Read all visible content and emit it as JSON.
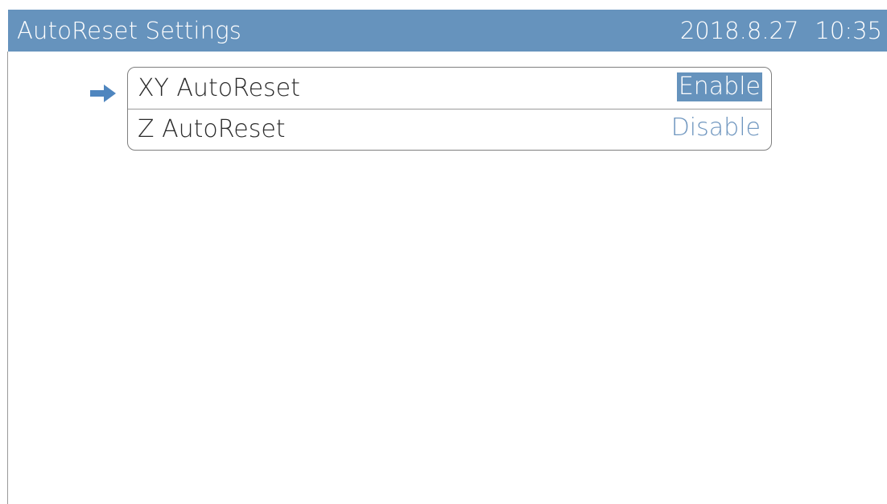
{
  "header": {
    "title": "AutoReset Settings",
    "date": "2018.8.27",
    "time": "10:35"
  },
  "settings": {
    "items": [
      {
        "label": "XY AutoReset",
        "value": "Enable"
      },
      {
        "label": "Z AutoReset",
        "value": "Disable"
      }
    ]
  },
  "colors": {
    "accent": "#6693bd",
    "value_text": "#6f96bf",
    "pointer": "#4f86bf"
  },
  "icons": {
    "pointer": "arrow-right-icon"
  }
}
